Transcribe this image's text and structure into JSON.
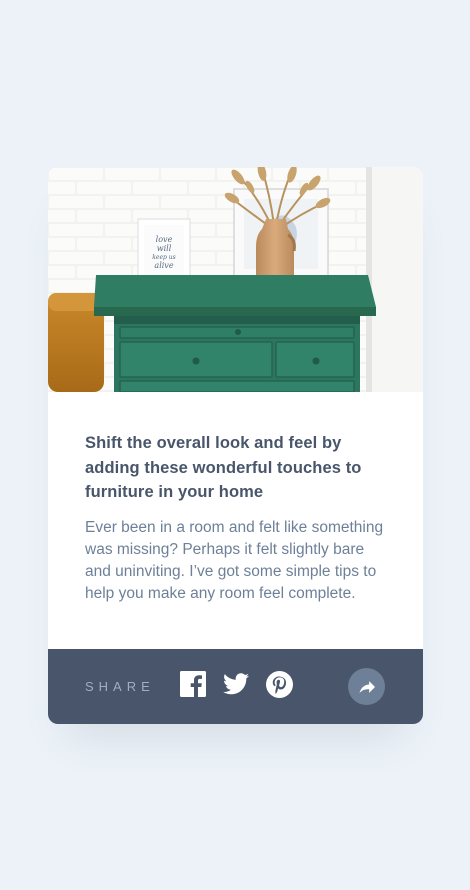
{
  "article": {
    "title": "Shift the overall look and feel by adding these wonderful touches to furniture in your home",
    "excerpt": "Ever been in a room and felt like something was missing? Perhaps it felt slightly bare and uninviting. I’ve got some simple tips to help you make any room feel complete.",
    "image_icon": "drawers-photo",
    "framed_art_text": [
      "love",
      "will",
      "keep us",
      "alive"
    ]
  },
  "share": {
    "label": "SHARE",
    "icons": [
      "facebook-icon",
      "twitter-icon",
      "pinterest-icon"
    ],
    "button_icon": "share-arrow-icon"
  },
  "colors": {
    "page_background": "#ecf2f8",
    "card_background": "#ffffff",
    "footer_background": "#48556a",
    "title": "#48556a",
    "body_text": "#6e8098",
    "share_label": "#9eafc2",
    "share_button": "#6e8098",
    "dresser_green": "#2e7a62"
  }
}
